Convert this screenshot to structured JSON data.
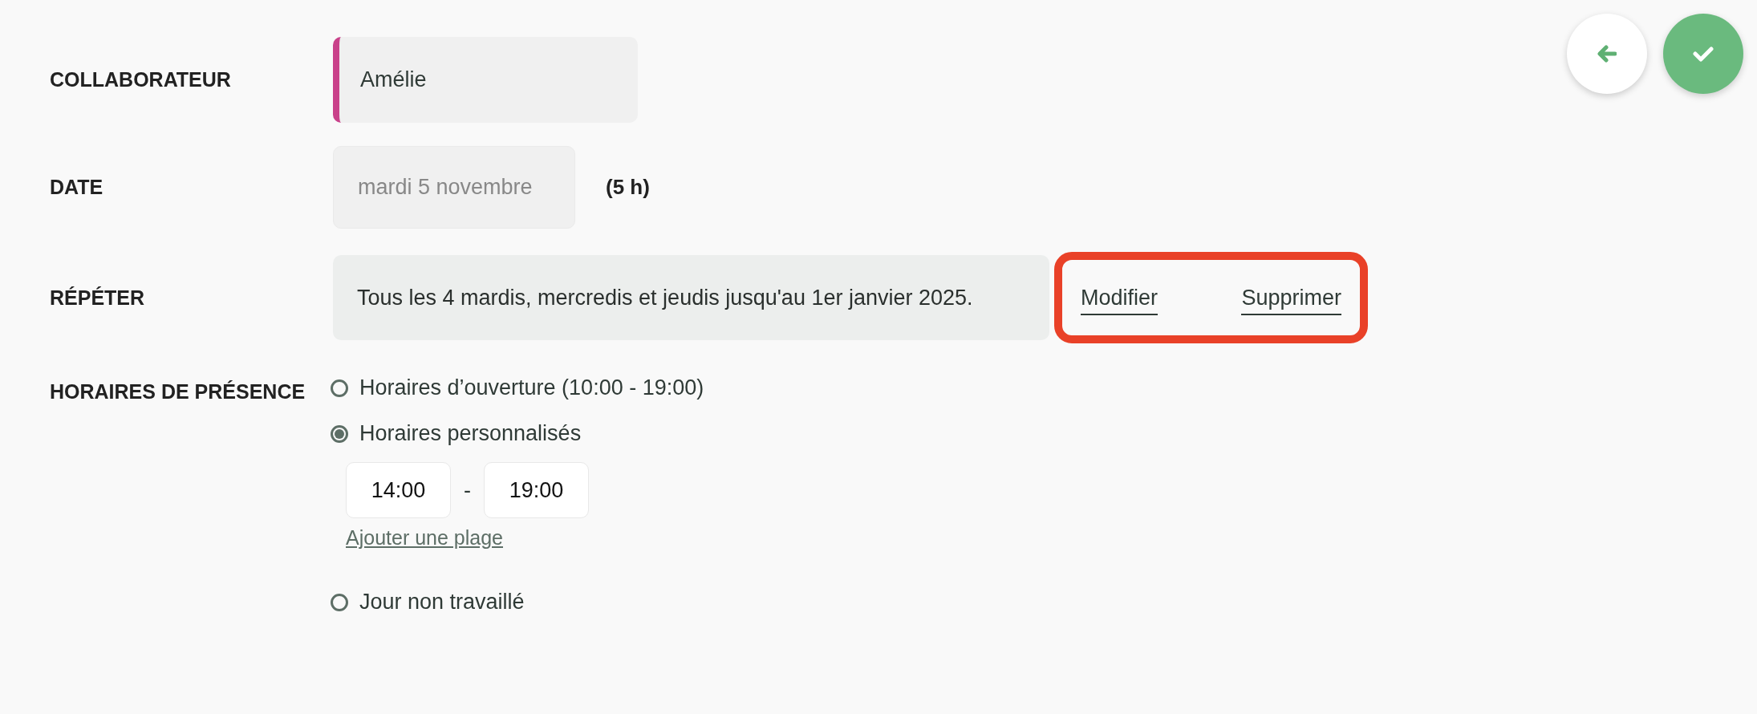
{
  "header_buttons": [
    {
      "kind": "back"
    },
    {
      "kind": "confirm"
    }
  ],
  "collaborator": {
    "label": "COLLABORATEUR",
    "value": "Amélie",
    "color": "#c9418a"
  },
  "date": {
    "label": "DATE",
    "value": "mardi 5 novembre",
    "duration": "(5 h)"
  },
  "repeat": {
    "label": "RÉPÉTER",
    "value": "Tous les 4 mardis, mercredis et jeudis jusqu'au 1er janvier 2025.",
    "highlighted": true,
    "actions": [
      "Modifier",
      "Supprimer"
    ]
  },
  "presence": {
    "label": "HORAIRES DE PRÉSENCE",
    "options": [
      {
        "label": "Horaires d’ouverture (10:00 - 19:00)",
        "selected": false
      },
      {
        "label": "Horaires personnalisés",
        "selected": true,
        "ranges": [
          {
            "start": "14:00",
            "separator": "-",
            "end": "19:00"
          }
        ],
        "add_link": "Ajouter une plage"
      },
      {
        "label": "Jour non travaillé",
        "selected": false
      }
    ]
  }
}
